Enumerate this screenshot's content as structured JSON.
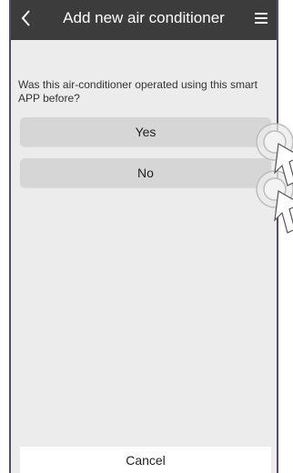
{
  "header": {
    "back_icon": "chevron-left-icon",
    "title": "Add new air conditioner",
    "menu_icon": "hamburger-menu-icon"
  },
  "question": {
    "text": "Was this air-conditioner operated using this smart APP before?"
  },
  "options": {
    "yes_label": "Yes",
    "no_label": "No"
  },
  "footer": {
    "cancel_label": "Cancel"
  },
  "colors": {
    "header_bg": "#3c3c3c",
    "option_bg": "#d6d6d6",
    "frame_border": "#5a4a6a"
  }
}
